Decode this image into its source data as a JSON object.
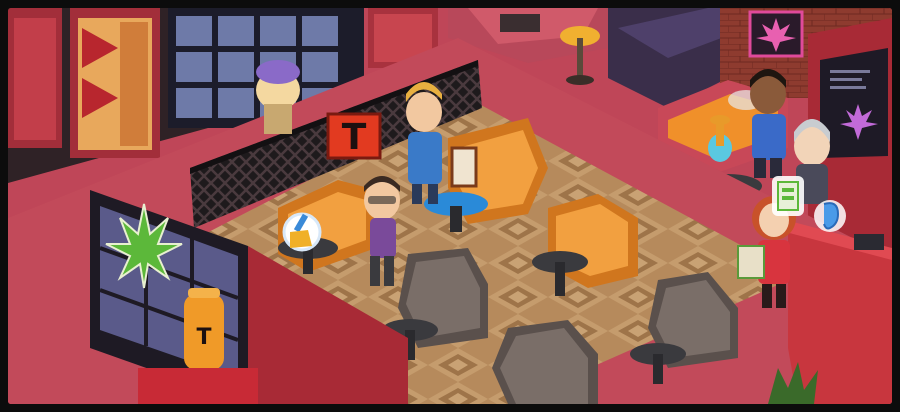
{
  "scene": {
    "type": "isometric-cafe",
    "wall_sign_letter": "T",
    "bottle_letter": "T",
    "colors": {
      "floor_red": "#c14a5c",
      "carpet_tan": "#b98f62",
      "carpet_dark": "#8f6845",
      "booth_orange": "#e8902a",
      "booth_gray": "#6b625e",
      "table_dark": "#3a3a3e",
      "wall_red": "#a8323e",
      "lattice": "#2b2628",
      "neon_pink": "#e04a9a",
      "cannabis_green": "#5cb83a"
    }
  },
  "characters": [
    {
      "name": "purple-cap-customer",
      "icon": "person-icon"
    },
    {
      "name": "blonde-man-customer",
      "icon": "person-icon"
    },
    {
      "name": "mustache-man-customer",
      "icon": "person-icon"
    },
    {
      "name": "redhead-waitress",
      "icon": "person-icon"
    },
    {
      "name": "dreadlocks-customer",
      "icon": "person-icon"
    },
    {
      "name": "gray-hair-customer",
      "icon": "person-icon"
    }
  ],
  "bubbles": [
    {
      "name": "broom-cleaning-bubble",
      "icon": "broom-icon"
    },
    {
      "name": "menu-order-bubble",
      "icon": "menu-card-icon"
    },
    {
      "name": "ear-listen-bubble",
      "icon": "ear-icon"
    }
  ]
}
